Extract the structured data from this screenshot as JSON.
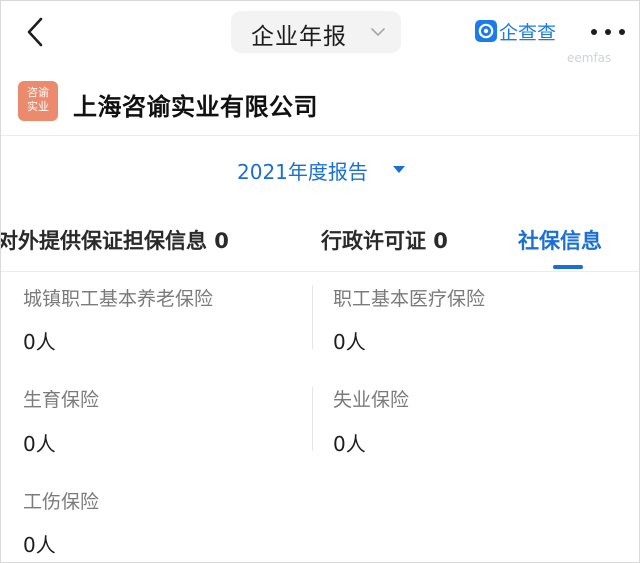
{
  "nav": {
    "title": "企业年报",
    "brand_name": "企查查",
    "watermark": "eemfas"
  },
  "company": {
    "logo_line1": "咨谕",
    "logo_line2": "实业",
    "name": "上海咨谕实业有限公司"
  },
  "report": {
    "year_label": "2021年度报告"
  },
  "tabs": [
    {
      "label": "对外提供保证担保信息 0"
    },
    {
      "label": "行政许可证 0"
    },
    {
      "label": "社保信息"
    }
  ],
  "social_insurance": [
    {
      "label": "城镇职工基本养老保险",
      "value": "0人"
    },
    {
      "label": "职工基本医疗保险",
      "value": "0人"
    },
    {
      "label": "生育保险",
      "value": "0人"
    },
    {
      "label": "失业保险",
      "value": "0人"
    },
    {
      "label": "工伤保险",
      "value": "0人"
    }
  ],
  "colors": {
    "accent": "#1a6fd6",
    "brand": "#1a7bea",
    "logo_bg": "#ec8a6e"
  }
}
